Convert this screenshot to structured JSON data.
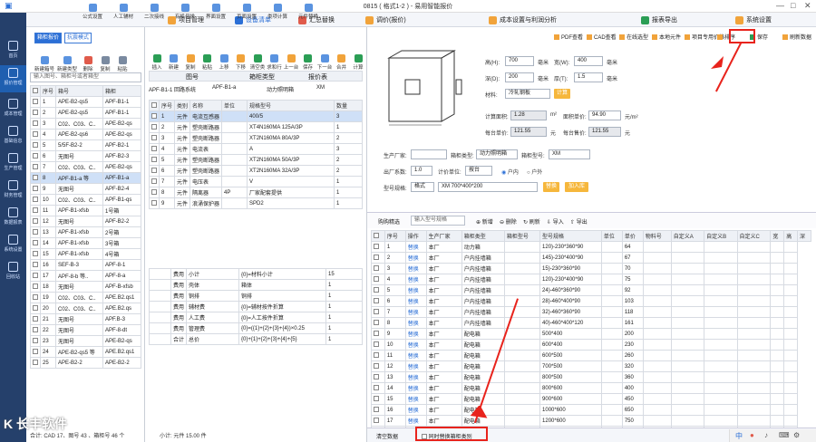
{
  "window": {
    "title": "0815 ( 格式1-2 )  - 易用智能报价"
  },
  "sidebar": {
    "items": [
      {
        "label": "首页"
      },
      {
        "label": "报价管理"
      },
      {
        "label": "成本管理"
      },
      {
        "label": "基础信息"
      },
      {
        "label": "生产管理"
      },
      {
        "label": "财务管理"
      },
      {
        "label": "数据报表"
      },
      {
        "label": "系统设置"
      },
      {
        "label": "回收站"
      }
    ]
  },
  "menubar": {
    "items": [
      {
        "label": "项目管理"
      },
      {
        "label": "设备清单"
      },
      {
        "label": "汇总替换"
      },
      {
        "label": "调价(报价)"
      },
      {
        "label": "成本设置与利润分析"
      },
      {
        "label": "报表导出"
      },
      {
        "label": "系统设置"
      }
    ]
  },
  "left": {
    "tab_a": "箱柜报价",
    "tab_b": "抗震模式",
    "tools_top": [
      "公式设置",
      "人工辅材",
      "二次接线",
      "有机母排",
      "界面设置",
      "页面设置",
      "类项计算",
      "元件替换"
    ],
    "tools": [
      "新建箱号",
      "新建类型",
      "删除",
      "复制",
      "粘贴"
    ],
    "search_placeholder": "输入图号、箱柜号或者箱型",
    "columns": [
      "序号",
      "箱号",
      "箱柜"
    ],
    "rows": [
      {
        "n": "1",
        "a": "APE-B2-qs5",
        "b": "APF-B1-1"
      },
      {
        "n": "2",
        "a": "APE-B2-qs5",
        "b": "APF-B1-1"
      },
      {
        "n": "3",
        "a": "C02、C03、C..",
        "b": "APE-B2-qs"
      },
      {
        "n": "4",
        "a": "APE-B2-qs6",
        "b": "APE-B2-qs"
      },
      {
        "n": "5",
        "a": "5/5F-B2-2",
        "b": "APF-B2-1"
      },
      {
        "n": "6",
        "a": "无图号",
        "b": "APF-B2-3"
      },
      {
        "n": "7",
        "a": "C02、C03、C..",
        "b": "APE-B2-qs"
      },
      {
        "n": "8",
        "a": "APF-B1-a 等",
        "b": "APF-B1-a"
      },
      {
        "n": "9",
        "a": "无图号",
        "b": "APF-B2-4"
      },
      {
        "n": "10",
        "a": "C02、C03、C..",
        "b": "APF-B1-qs"
      },
      {
        "n": "11",
        "a": "APF-B1-xfsb",
        "b": "1号箱"
      },
      {
        "n": "12",
        "a": "无图号",
        "b": "APF-B2-2"
      },
      {
        "n": "13",
        "a": "APF-B1-xfsb",
        "b": "2号箱"
      },
      {
        "n": "14",
        "a": "APF-B1-xfsb",
        "b": "3号箱"
      },
      {
        "n": "15",
        "a": "APF-B1-xfsb",
        "b": "4号箱"
      },
      {
        "n": "16",
        "a": "SEF-B-3",
        "b": "APF-8-1"
      },
      {
        "n": "17",
        "a": "APF-8-b 等..",
        "b": "APF-8-a"
      },
      {
        "n": "18",
        "a": "无图号",
        "b": "APF-B-xfsb"
      },
      {
        "n": "19",
        "a": "C02、C03、C..",
        "b": "APE.B2.qs1"
      },
      {
        "n": "20",
        "a": "C02、C03、C..",
        "b": "APE.B2.qs"
      },
      {
        "n": "21",
        "a": "无图号",
        "b": "APF.B-3"
      },
      {
        "n": "22",
        "a": "无图号",
        "b": "APF-8-dt"
      },
      {
        "n": "23",
        "a": "无图号",
        "b": "APE-B2-qs"
      },
      {
        "n": "24",
        "a": "APE-B2-qs5 等",
        "b": "APE.B2.qs1"
      },
      {
        "n": "25",
        "a": "APE-B2-2",
        "b": "APE-B2-2"
      }
    ],
    "status": "合计: CAD 17、图号 43 、箱柜号 46 个"
  },
  "mid": {
    "tools": [
      "插入",
      "新建",
      "复制",
      "粘贴",
      "上移",
      "下移",
      "清空类属性",
      "求和行",
      "上一台",
      "保存",
      "下一台",
      "合并",
      "计算"
    ],
    "tabs": [
      "图号",
      "箱柜类型",
      "报价表"
    ],
    "path": [
      "APF-B1-1 回路系统",
      "APF-B1-a",
      "动力照明箱",
      "XM"
    ],
    "columns": [
      "序号",
      "类别",
      "名称",
      "单位",
      "规格型号",
      "数量"
    ],
    "rows": [
      {
        "n": "1",
        "cat": "元件",
        "name": "电流互感器",
        "unit": "",
        "spec": "400/5",
        "qty": "3"
      },
      {
        "n": "2",
        "cat": "元件",
        "name": "塑壳断路器",
        "unit": "",
        "spec": "XT4N160MA 125A/3P",
        "qty": "1"
      },
      {
        "n": "3",
        "cat": "元件",
        "name": "塑壳断路器",
        "unit": "",
        "spec": "XT2N160MA 80A/3P",
        "qty": "2"
      },
      {
        "n": "4",
        "cat": "元件",
        "name": "电流表",
        "unit": "",
        "spec": "A",
        "qty": "3"
      },
      {
        "n": "5",
        "cat": "元件",
        "name": "塑壳断路器",
        "unit": "",
        "spec": "XT2N160MA 50A/3P",
        "qty": "2"
      },
      {
        "n": "6",
        "cat": "元件",
        "name": "塑壳断路器",
        "unit": "",
        "spec": "XT2N160MA 32A/3P",
        "qty": "2"
      },
      {
        "n": "7",
        "cat": "元件",
        "name": "电压表",
        "unit": "",
        "spec": "V",
        "qty": "1"
      },
      {
        "n": "8",
        "cat": "元件",
        "name": "隔离器",
        "unit": "4P",
        "spec": "厂家配套提供",
        "qty": "1"
      },
      {
        "n": "9",
        "cat": "元件",
        "name": "浪涌保护器",
        "unit": "",
        "spec": "SPD2",
        "qty": "1"
      }
    ],
    "summary_rows": [
      {
        "cat": "费用",
        "name": "小计",
        "spec": "{0}=材料小计",
        "qty": "15"
      },
      {
        "cat": "费用",
        "name": "壳体",
        "spec": "箱体",
        "qty": "1"
      },
      {
        "cat": "费用",
        "name": "铜排",
        "spec": "铜排",
        "qty": "1"
      },
      {
        "cat": "费用",
        "name": "辅材费",
        "spec": "{0}=辅材按件折算",
        "qty": "1"
      },
      {
        "cat": "费用",
        "name": "人工费",
        "spec": "{0}=人工按件折算",
        "qty": "1"
      },
      {
        "cat": "费用",
        "name": "管理费",
        "spec": "{0}=({1}+{2}+{3}+{4})×0.25",
        "qty": "1"
      },
      {
        "cat": "合计",
        "name": "总价",
        "spec": "{0}+{1}+{2}+{3}+{4}+{5}",
        "qty": "1"
      }
    ],
    "status": "小计: 元件 15.00 件"
  },
  "right": {
    "toolbar": [
      "PDF查看",
      "CAD查看",
      "在线选型",
      "本地元件",
      "项目专用价格",
      "排序",
      "保存",
      "刷新数据"
    ],
    "sort_label": "排序",
    "dims": {
      "h_label": "高(H):",
      "h_val": "700",
      "w_label": "宽(W):",
      "w_val": "400",
      "mm": "毫米",
      "d_label": "深(D):",
      "d_val": "200",
      "t_label": "厚(T):",
      "t_val": "1.5",
      "mat_label": "材料:",
      "mat_val": "冷轧钢板",
      "calc_btn": "计算",
      "area_label": "计算面积:",
      "area_val": "1.28",
      "area_unit": "m²",
      "price_label": "面积单价:",
      "price_val": "94.90",
      "price_unit": "元/m²",
      "unit_label": "每台单价:",
      "unit_val": "121.55",
      "yuan": "元",
      "unit2_label": "每台售价:",
      "unit2_val": "121.55"
    },
    "mfr_label": "生产厂家:",
    "cab_type_label": "箱柜类型:",
    "cab_type_val": "动力照明箱",
    "model_label": "箱柜型号:",
    "model_val": "XM",
    "count_label": "出厂系数:",
    "count_val": "1.0",
    "unit_sel_label": "计价单位:",
    "unit_sel_val": "按台",
    "radio_a": "户内",
    "radio_b": "户外",
    "spec_label": "型号规格:",
    "spec_mode": "格式",
    "spec_val": "XM 700*400*200",
    "spec_btn": "替换",
    "add_btn": "加入库",
    "bottom_toolbar": [
      "新增",
      "删除",
      "刷新",
      "导入",
      "导出"
    ],
    "bottom_search_placeholder": "输入型号规格",
    "bottom_title": "购购精选",
    "columns": [
      "序号",
      "操作",
      "生产厂家",
      "箱柜类型",
      "箱柜型号",
      "型号规格",
      "单位",
      "单价",
      "物料号",
      "自定义A",
      "自定义B",
      "自定义C",
      "宽",
      "高",
      "深"
    ],
    "rows": [
      {
        "n": "1",
        "op": "替换",
        "mf": "本厂",
        "t": "动力箱",
        "s": "120)-230*360*90",
        "p": "64"
      },
      {
        "n": "2",
        "op": "替换",
        "mf": "本厂",
        "t": "户内挂墙箱",
        "s": "145)-230*400*90",
        "p": "67"
      },
      {
        "n": "3",
        "op": "替换",
        "mf": "本厂",
        "t": "户内挂墙箱",
        "s": "15)-230*360*90",
        "p": "70"
      },
      {
        "n": "4",
        "op": "替换",
        "mf": "本厂",
        "t": "户内挂墙箱",
        "s": "120)-230*400*90",
        "p": "75"
      },
      {
        "n": "5",
        "op": "替换",
        "mf": "本厂",
        "t": "户内挂墙箱",
        "s": "24)-460*360*90",
        "p": "92"
      },
      {
        "n": "6",
        "op": "替换",
        "mf": "本厂",
        "t": "户内挂墙箱",
        "s": "28)-460*400*90",
        "p": "103"
      },
      {
        "n": "7",
        "op": "替换",
        "mf": "本厂",
        "t": "户内挂墙箱",
        "s": "32)-460*360*90",
        "p": "118"
      },
      {
        "n": "8",
        "op": "替换",
        "mf": "本厂",
        "t": "户内挂墙箱",
        "s": "40)-460*400*120",
        "p": "161"
      },
      {
        "n": "9",
        "op": "替换",
        "mf": "本厂",
        "t": "配电箱",
        "s": "500*400",
        "p": "200"
      },
      {
        "n": "10",
        "op": "替换",
        "mf": "本厂",
        "t": "配电箱",
        "s": "600*400",
        "p": "230"
      },
      {
        "n": "11",
        "op": "替换",
        "mf": "本厂",
        "t": "配电箱",
        "s": "600*500",
        "p": "260"
      },
      {
        "n": "12",
        "op": "替换",
        "mf": "本厂",
        "t": "配电箱",
        "s": "700*500",
        "p": "320"
      },
      {
        "n": "13",
        "op": "替换",
        "mf": "本厂",
        "t": "配电箱",
        "s": "800*500",
        "p": "360"
      },
      {
        "n": "14",
        "op": "替换",
        "mf": "本厂",
        "t": "配电箱",
        "s": "800*600",
        "p": "400"
      },
      {
        "n": "15",
        "op": "替换",
        "mf": "本厂",
        "t": "配电箱",
        "s": "900*600",
        "p": "450"
      },
      {
        "n": "16",
        "op": "替换",
        "mf": "本厂",
        "t": "配电箱",
        "s": "1000*600",
        "p": "650"
      },
      {
        "n": "17",
        "op": "替换",
        "mf": "本厂",
        "t": "配电箱",
        "s": "1200*600",
        "p": "750"
      },
      {
        "n": "18",
        "op": "替换",
        "mf": "本厂",
        "t": "配电箱",
        "s": "1600*600",
        "p": "850"
      }
    ],
    "footer_left": "清空数据",
    "footer_check": "同时替换箱柜类别"
  },
  "watermark": "K 长丰软件",
  "colors": {
    "accent": "#2b6fd6",
    "sidebar": "#25406b",
    "highlight": "#e8231c",
    "orange": "#f6b73c"
  }
}
